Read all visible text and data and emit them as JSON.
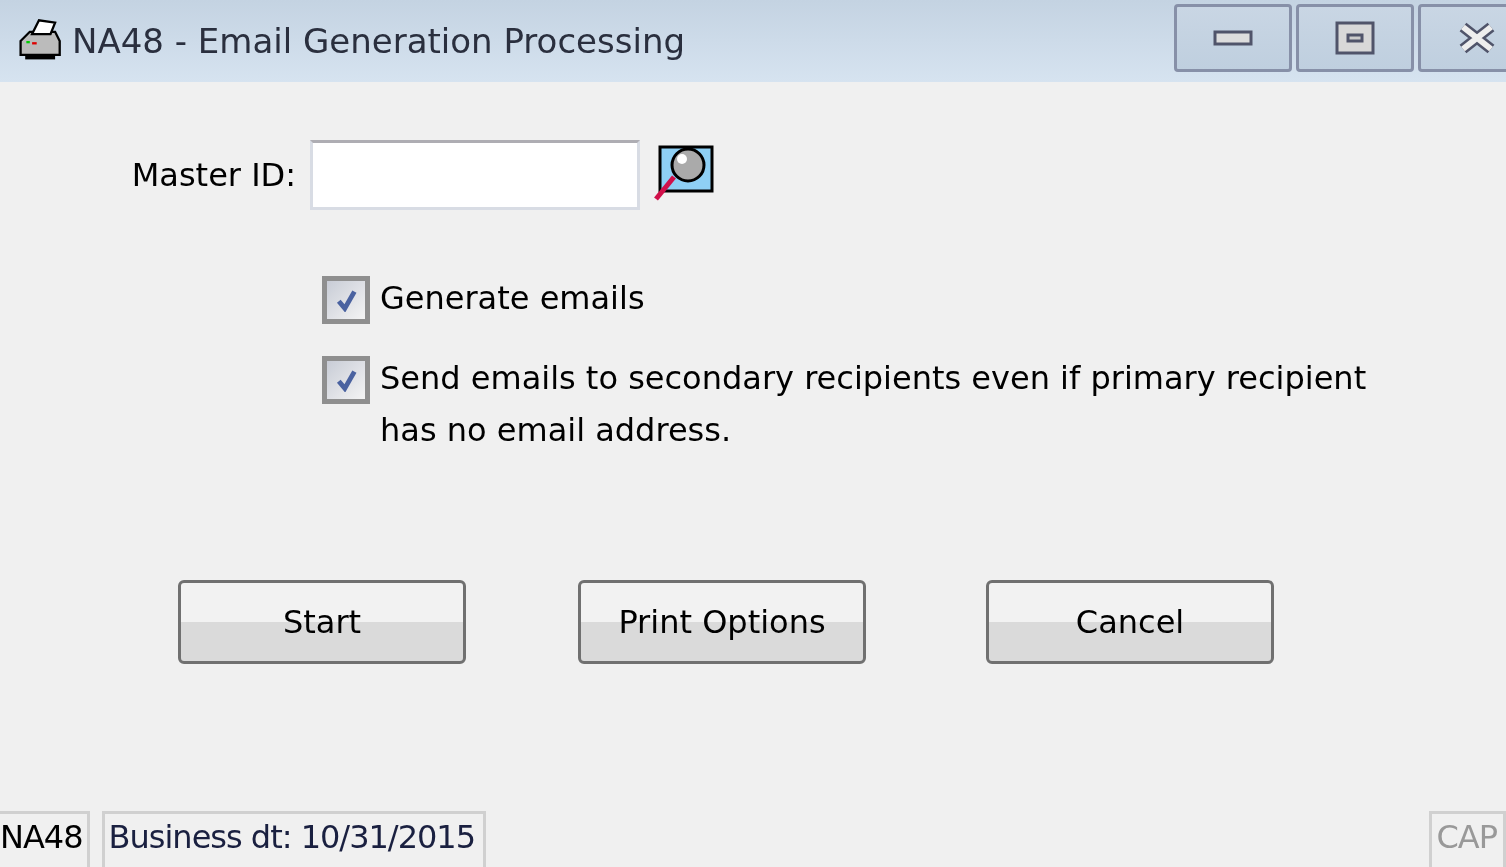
{
  "window": {
    "title": "NA48 - Email Generation Processing"
  },
  "master_id": {
    "label": "Master ID:"
  },
  "options": [
    {
      "label": "Generate emails",
      "checked": true
    },
    {
      "label": "Send emails to secondary recipients even if primary recipient has no email address.",
      "checked": true
    }
  ],
  "buttons": [
    "Start",
    "Print Options",
    "Cancel"
  ],
  "status_bar": {
    "screen_code": "NA48",
    "business_date": "Business dt: 10/31/2015",
    "caps": "CAP"
  }
}
